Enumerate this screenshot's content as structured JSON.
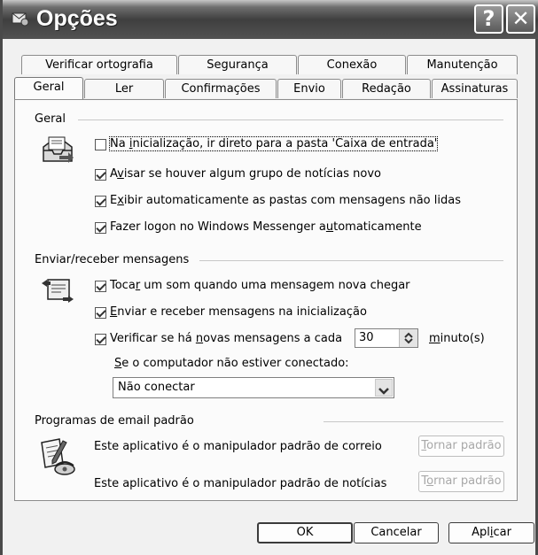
{
  "window": {
    "title": "Opções",
    "help_label": "?",
    "close_label": "✕"
  },
  "tabs_row1": [
    {
      "label": "Verificar ortografia"
    },
    {
      "label": "Segurança"
    },
    {
      "label": "Conexão"
    },
    {
      "label": "Manutenção"
    }
  ],
  "tabs_row2": [
    {
      "label": "Geral",
      "active": true
    },
    {
      "label": "Ler"
    },
    {
      "label": "Confirmações"
    },
    {
      "label": "Envio"
    },
    {
      "label": "Redação"
    },
    {
      "label": "Assinaturas"
    }
  ],
  "general": {
    "heading": "Geral",
    "options": [
      {
        "pre": "Na ",
        "acc": "i",
        "post": "nicialização, ir direto para a pasta 'Caixa de entrada'",
        "checked": false
      },
      {
        "pre": "A",
        "acc": "v",
        "post": "isar se houver algum grupo de notícias novo",
        "checked": true
      },
      {
        "pre": "E",
        "acc": "x",
        "post": "ibir automaticamente as pastas com mensagens não lidas",
        "checked": true
      },
      {
        "pre": "Fazer logon no Windows Messenger a",
        "acc": "u",
        "post": "tomaticamente",
        "checked": true
      }
    ]
  },
  "send_receive": {
    "heading": "Enviar/receber mensagens",
    "options": [
      {
        "pre": "Toca",
        "acc": "r",
        "post": " um som quando uma mensagem nova chegar",
        "checked": true
      },
      {
        "pre": "",
        "acc": "E",
        "post": "nviar e receber mensagens na inicialização",
        "checked": true
      },
      {
        "pre": "Verificar se há ",
        "acc": "n",
        "post": "ovas mensagens a cada",
        "checked": true
      }
    ],
    "interval_value": "30",
    "interval_unit_acc": "m",
    "interval_unit_rest": "inuto(s)",
    "offline_acc": "S",
    "offline_rest": "e o computador não estiver conectado:",
    "offline_selected": "Não conectar"
  },
  "default_programs": {
    "heading": "Programas de email padrão",
    "mail_text": "Este aplicativo é o manipulador padrão de correio",
    "mail_button_acc": "T",
    "mail_button_rest": "ornar padrão",
    "news_text": "Este aplicativo é o manipulador padrão de notícias",
    "news_button_pre": "T",
    "news_button_acc": "o",
    "news_button_rest": "rnar padrão"
  },
  "footer": {
    "ok": "OK",
    "cancel": "Cancelar",
    "apply_pre": "Apl",
    "apply_acc": "i",
    "apply_post": "car"
  },
  "icons": {
    "title": "mail-options-icon",
    "general": "inbox-tray-icon",
    "send_receive": "send-receive-icon",
    "default_programs": "mail-pen-phone-icon",
    "spin": "spin-arrows-icon",
    "dropdown": "chevron-down-icon"
  }
}
